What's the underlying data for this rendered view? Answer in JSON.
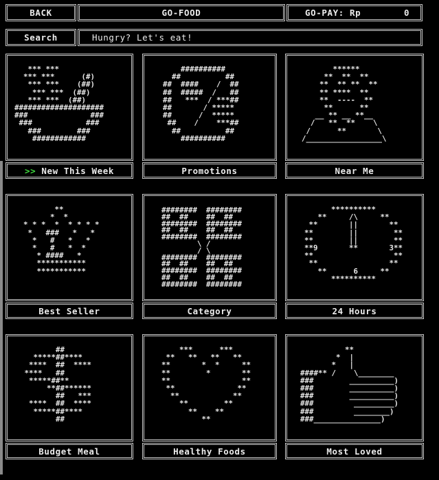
{
  "header": {
    "back_label": "BACK",
    "title": "GO-FOOD",
    "gopay_label": "GO-PAY: Rp",
    "gopay_amount": "0"
  },
  "search": {
    "label": "Search",
    "value": "Hungry? Let's eat!"
  },
  "selected_marker": ">>",
  "tiles": [
    {
      "label": "New This Week",
      "selected": true,
      "art": "   *** ***\n  *** ***      (#)\n   *** ***    (##)\n    *** ***  (##)\n   *** ***  (##)\n####################\n###              ###\n ###            ###\n   ###        ###\n    ############"
    },
    {
      "label": "Promotions",
      "art": "      ##########\n    ##          ##\n  ##  ####    /  ##\n  ##  #####  /   ##\n  ##   ***  / ***##\n  ##       / *****\n  ##      /  *****\n   ##    /    ***##\n    ##          ##\n      ##########"
    },
    {
      "label": "Near Me",
      "art": "         ******\n       **  **  **\n      **  ** **  **\n      ** ****  **\n      **  ----  **\n       **      **\n     __ ** __ **__\n    /   **  **    \\\n   /      **       \\\n  /_________________\\"
    },
    {
      "label": "Best Seller",
      "art": "         **\n        *  *\n  * * *  *  * * * *\n   *   ###   *   *\n    *   #   *   *\n    *   #   *  *\n     * ####   *\n     ***********\n     ***********"
    },
    {
      "label": "Category",
      "art": "  ########  ########\n  ##  ##    ##  ##\n  ########  ########\n  ##  ##    ##  ##\n  ########  ########\n          \\ /\n          / \\\n  ########  ########\n  ##  ##    ##  ##\n  ########  ########\n  ##  ##    ##  ##\n  ########  ########"
    },
    {
      "label": "24 Hours",
      "art": "        **********\n     **     /\\     **\n   **       ||       **\n  **        ||        **\n  **        ||        **\n  **9       **       3**\n  **                  **\n   **                **\n     **      6     **\n        **********"
    },
    {
      "label": "Budget Meal",
      "art": "        ##\n   *****##****\n  ****  ##  ****\n ****   ##   \n  *****##**\n      **##******\n        ##   ***\n  ****  ##  ****\n   *****##****\n        ##"
    },
    {
      "label": "Healthy Foods",
      "art": "      ***      ***\n   **   **   **   **\n  **       *  *     **\n  **        *       **\n  **                **\n   **              **\n    **            **\n      **        **\n        **    **\n           **"
    },
    {
      "label": "Most Loved",
      "art": "            **\n          *  |\n         *   |\n  ####** /    \\________\n  ###        __________)\n  ###        __________)\n  ###        __________)\n  ###         _________)\n  ###         ________)\n  ###_______________)"
    }
  ]
}
